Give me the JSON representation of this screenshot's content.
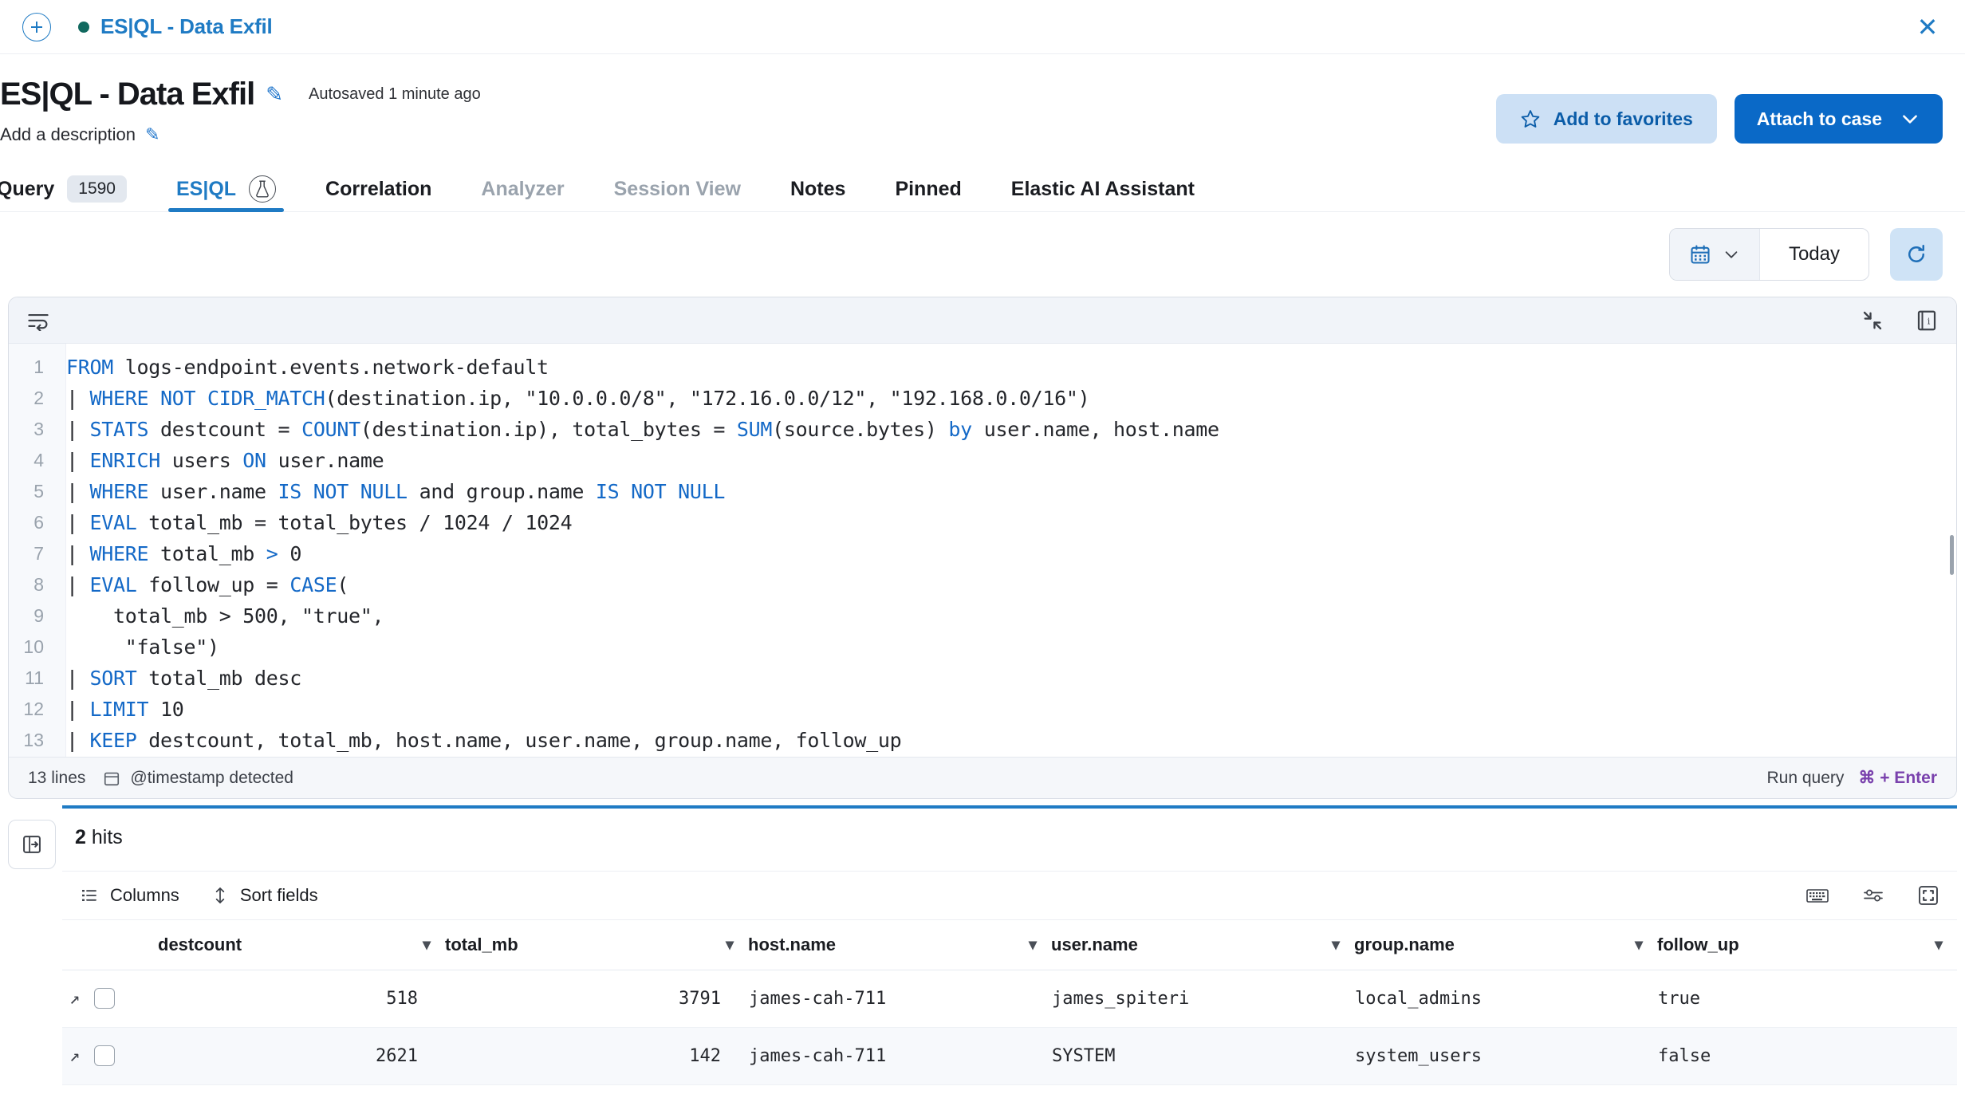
{
  "flyout": {
    "add_label": "+",
    "tab_title": "ES|QL - Data Exfil",
    "close_label": "✕"
  },
  "header": {
    "title": "ES|QL - Data Exfil",
    "autosaved": "Autosaved 1 minute ago",
    "description_placeholder": "Add a description",
    "favorites_label": "Add to favorites",
    "attach_case_label": "Attach to case",
    "accent_color": "#0a69c7",
    "favorites_bg": "#cce0f5"
  },
  "tabs": [
    {
      "label": "Query",
      "count": "1590",
      "state": "normal"
    },
    {
      "label": "ES|QL",
      "state": "active",
      "icon": "beaker-icon"
    },
    {
      "label": "Correlation",
      "state": "normal"
    },
    {
      "label": "Analyzer",
      "state": "disabled"
    },
    {
      "label": "Session View",
      "state": "disabled"
    },
    {
      "label": "Notes",
      "state": "normal"
    },
    {
      "label": "Pinned",
      "state": "normal"
    },
    {
      "label": "Elastic AI Assistant",
      "state": "normal"
    }
  ],
  "datepicker": {
    "quick_select_icon": "calendar-icon",
    "range_label": "Today",
    "refresh_icon": "refresh-icon"
  },
  "editor": {
    "wrap_icon": "word-wrap-icon",
    "collapse_icon": "collapse-icon",
    "docs_icon": "documentation-book-icon",
    "lines": [
      {
        "n": "1",
        "prefix": "",
        "segments": [
          {
            "t": "FROM",
            "k": true
          },
          {
            "t": " logs-endpoint.events.network-default",
            "k": false
          }
        ]
      },
      {
        "n": "2",
        "prefix": "| ",
        "segments": [
          {
            "t": "WHERE NOT CIDR_MATCH",
            "k": true
          },
          {
            "t": "(destination.ip, \"10.0.0.0/8\", \"172.16.0.0/12\", \"192.168.0.0/16\")",
            "k": false
          }
        ]
      },
      {
        "n": "3",
        "prefix": "| ",
        "segments": [
          {
            "t": "STATS",
            "k": true
          },
          {
            "t": " destcount = ",
            "k": false
          },
          {
            "t": "COUNT",
            "k": true
          },
          {
            "t": "(destination.ip), total_bytes = ",
            "k": false
          },
          {
            "t": "SUM",
            "k": true
          },
          {
            "t": "(source.bytes) ",
            "k": false
          },
          {
            "t": "by",
            "k": true
          },
          {
            "t": " user.name, host.name",
            "k": false
          }
        ]
      },
      {
        "n": "4",
        "prefix": "| ",
        "segments": [
          {
            "t": "ENRICH",
            "k": true
          },
          {
            "t": " users ",
            "k": false
          },
          {
            "t": "ON",
            "k": true
          },
          {
            "t": " user.name",
            "k": false
          }
        ]
      },
      {
        "n": "5",
        "prefix": "| ",
        "segments": [
          {
            "t": "WHERE",
            "k": true
          },
          {
            "t": " user.name ",
            "k": false
          },
          {
            "t": "IS NOT NULL",
            "k": true
          },
          {
            "t": " and group.name ",
            "k": false
          },
          {
            "t": "IS NOT NULL",
            "k": true
          }
        ]
      },
      {
        "n": "6",
        "prefix": "| ",
        "segments": [
          {
            "t": "EVAL",
            "k": true
          },
          {
            "t": " total_mb = total_bytes / 1024 / 1024",
            "k": false
          }
        ]
      },
      {
        "n": "7",
        "prefix": "| ",
        "segments": [
          {
            "t": "WHERE",
            "k": true
          },
          {
            "t": " total_mb ",
            "k": false
          },
          {
            "t": ">",
            "k": true
          },
          {
            "t": " 0",
            "k": false
          }
        ]
      },
      {
        "n": "8",
        "prefix": "| ",
        "segments": [
          {
            "t": "EVAL",
            "k": true
          },
          {
            "t": " follow_up = ",
            "k": false
          },
          {
            "t": "CASE",
            "k": true
          },
          {
            "t": "(",
            "k": false
          }
        ]
      },
      {
        "n": "9",
        "prefix": "",
        "segments": [
          {
            "t": "    total_mb > 500, \"true\",",
            "k": false
          }
        ]
      },
      {
        "n": "10",
        "prefix": "",
        "segments": [
          {
            "t": "     \"false\")",
            "k": false
          }
        ]
      },
      {
        "n": "11",
        "prefix": "| ",
        "segments": [
          {
            "t": "SORT",
            "k": true
          },
          {
            "t": " total_mb desc",
            "k": false
          }
        ]
      },
      {
        "n": "12",
        "prefix": "| ",
        "segments": [
          {
            "t": "LIMIT",
            "k": true
          },
          {
            "t": " 10",
            "k": false
          }
        ]
      },
      {
        "n": "13",
        "prefix": "| ",
        "segments": [
          {
            "t": "KEEP",
            "k": true
          },
          {
            "t": " destcount, total_mb, host.name, user.name, group.name, follow_up",
            "k": false
          }
        ]
      }
    ],
    "footer": {
      "line_count": "13 lines",
      "timestamp_icon": "calendar-icon",
      "timestamp_detected": "@timestamp detected",
      "run_label": "Run query",
      "shortcut": "⌘ + Enter"
    }
  },
  "results": {
    "expand_icon": "expand-panel-icon",
    "hits_count": "2",
    "hits_label": "hits",
    "toolbar": {
      "columns_label": "Columns",
      "sort_fields_label": "Sort fields",
      "keyboard_icon": "keyboard-icon",
      "settings_icon": "display-options-icon",
      "fullscreen_icon": "fullscreen-icon"
    },
    "columns": [
      {
        "label": "destcount",
        "align": "right"
      },
      {
        "label": "total_mb",
        "align": "right"
      },
      {
        "label": "host.name",
        "align": "left"
      },
      {
        "label": "user.name",
        "align": "left"
      },
      {
        "label": "group.name",
        "align": "left"
      },
      {
        "label": "follow_up",
        "align": "left"
      }
    ],
    "rows": [
      {
        "destcount": "518",
        "total_mb": "3791",
        "host_name": "james-cah-711",
        "user_name": "james_spiteri",
        "group_name": "local_admins",
        "follow_up": "true"
      },
      {
        "destcount": "2621",
        "total_mb": "142",
        "host_name": "james-cah-711",
        "user_name": "SYSTEM",
        "group_name": "system_users",
        "follow_up": "false"
      }
    ]
  }
}
